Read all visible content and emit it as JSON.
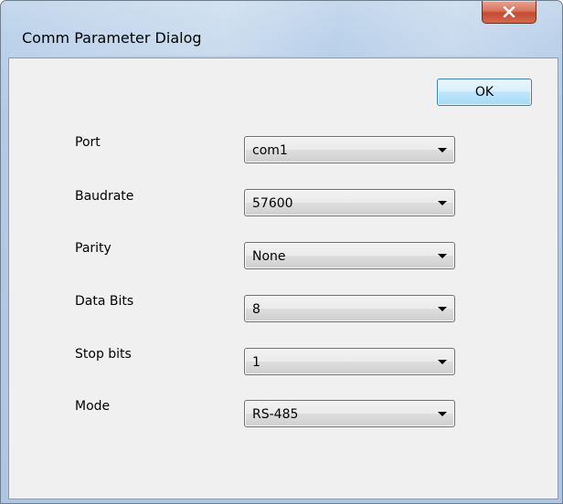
{
  "window": {
    "title": "Comm Parameter Dialog",
    "close_icon": "close-icon"
  },
  "buttons": {
    "ok_label": "OK"
  },
  "fields": [
    {
      "label": "Port",
      "value": "com1"
    },
    {
      "label": "Baudrate",
      "value": "57600"
    },
    {
      "label": "Parity",
      "value": "None"
    },
    {
      "label": "Data Bits",
      "value": "8"
    },
    {
      "label": "Stop bits",
      "value": "1"
    },
    {
      "label": "Mode",
      "value": "RS-485"
    }
  ],
  "colors": {
    "close_button": "#c44a32",
    "ok_button_border": "#3c7fb1",
    "client_background": "#f0f0f0"
  }
}
